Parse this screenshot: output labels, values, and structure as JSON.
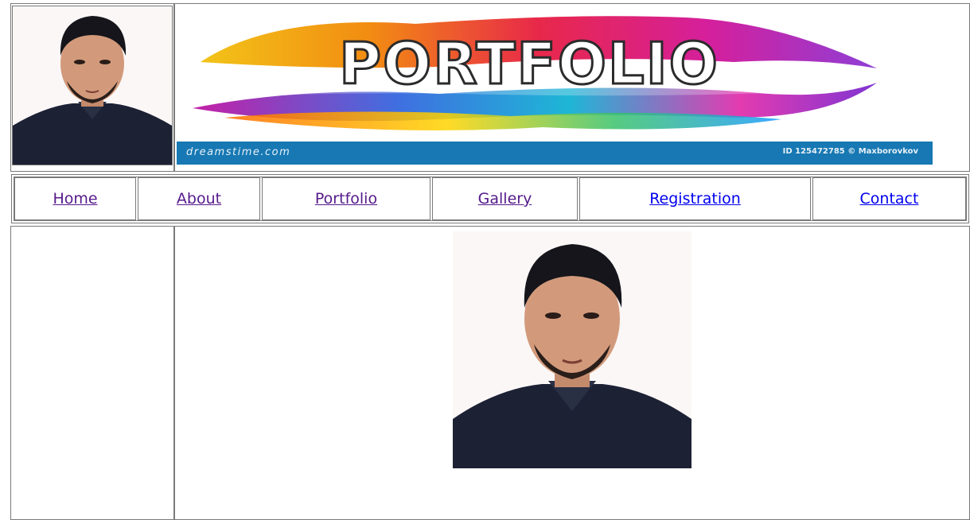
{
  "header": {
    "avatar_icon": "person-photo",
    "banner": {
      "word": "PORTFOLIO",
      "footer_site": "dreamstime.com",
      "footer_credit": "ID 125472785 © Maxborovkov"
    }
  },
  "nav": {
    "items": [
      {
        "label": "Home",
        "state": "visited"
      },
      {
        "label": "About",
        "state": "visited"
      },
      {
        "label": "Portfolio",
        "state": "visited"
      },
      {
        "label": "Gallery",
        "state": "visited"
      },
      {
        "label": "Registration",
        "state": "unvisited"
      },
      {
        "label": "Contact",
        "state": "unvisited"
      }
    ]
  },
  "content": {
    "main_image_icon": "person-photo"
  },
  "colors": {
    "link_visited": "#551a8b",
    "link_unvisited": "#0000ee",
    "banner_footer": "#1778b3"
  }
}
